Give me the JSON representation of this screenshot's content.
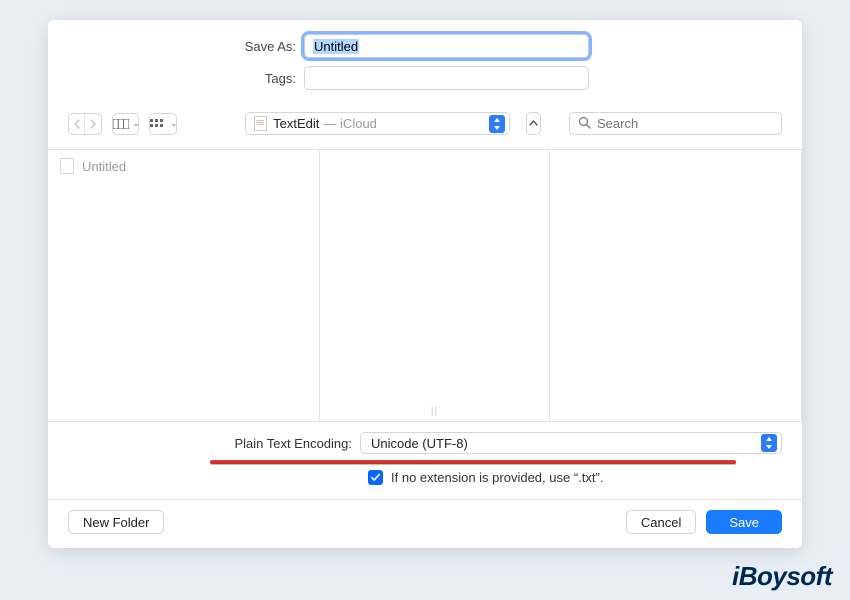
{
  "labels": {
    "save_as": "Save As:",
    "tags": "Tags:",
    "encoding": "Plain Text Encoding:",
    "use_ext": "If no extension is provided, use “.txt”."
  },
  "filename": "Untitled",
  "tags_value": "",
  "location": {
    "app": "TextEdit",
    "where": "iCloud"
  },
  "search": {
    "placeholder": "Search"
  },
  "sidebar_files": [
    "Untitled"
  ],
  "encoding_value": "Unicode (UTF-8)",
  "use_ext_checked": true,
  "buttons": {
    "new_folder": "New Folder",
    "cancel": "Cancel",
    "save": "Save"
  },
  "watermark": "iBoysoft"
}
